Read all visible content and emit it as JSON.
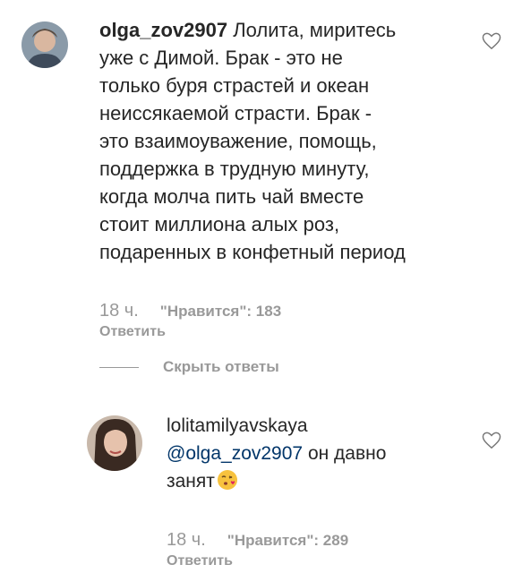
{
  "comments": [
    {
      "username": "olga_zov2907",
      "text_lines": [
        "Лолита, миритесь",
        "уже с Димой. Брак - это не",
        "только буря страстей и океан",
        "неиссякаемой страсти. Брак -",
        "это взаимоуважение, помощь,",
        "поддержка в трудную минуту,",
        "когда молча пить чай вместе",
        "стоит миллиона алых роз,",
        "подаренных в конфетный период"
      ],
      "time": "18 ч.",
      "likes": "\"Нравится\": 183",
      "reply": "Ответить"
    },
    {
      "username": "lolitamilyavskaya",
      "mention": "@olga_zov2907",
      "text_after_mention": " он давно",
      "text_line2": "занят",
      "emoji": "kissing-heart-emoji",
      "time": "18 ч.",
      "likes": "\"Нравится\": 289",
      "reply": "Ответить"
    }
  ],
  "hide_replies": "Скрыть ответы",
  "icons": {
    "like": "heart-outline-icon"
  },
  "colors": {
    "text": "#262626",
    "muted": "#999999",
    "mention": "#003569"
  }
}
